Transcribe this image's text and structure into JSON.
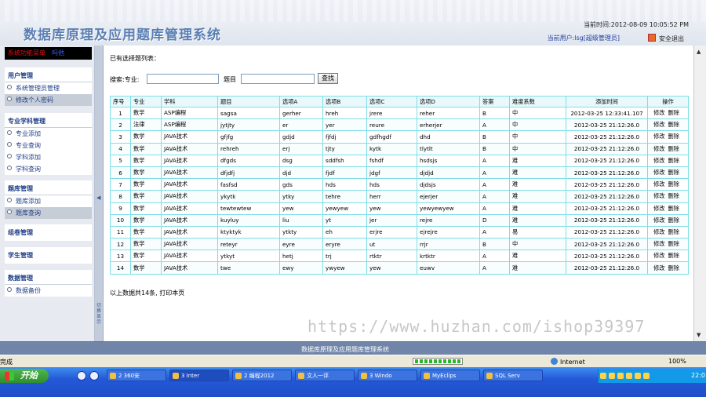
{
  "header": {
    "app_title": "数据库原理及应用题库管理系统",
    "current_time": "当前时间:2012-08-09 10:05:52 PM",
    "current_user": "当前用户:lsg[超级管理员]",
    "exit_label": "安全退出"
  },
  "sidebar": {
    "shortcut_label": "系统功能菜单",
    "shortcut_extra": "吗他",
    "sections": [
      {
        "title": "用户管理",
        "items": [
          "系统管理员管理",
          "修改个人密码"
        ]
      },
      {
        "title": "专业学科管理",
        "items": [
          "专业添加",
          "专业查询",
          "学科添加",
          "学科查询"
        ]
      },
      {
        "title": "题库管理",
        "items": [
          "题库添加",
          "题库查询"
        ]
      },
      {
        "title": "组卷管理",
        "items": []
      },
      {
        "title": "学生管理",
        "items": []
      },
      {
        "title": "数据管理",
        "items": [
          "数据备份"
        ]
      }
    ]
  },
  "main": {
    "list_title": "已有选择题列表：",
    "search_label": "搜索:专业:",
    "title_label": "题目",
    "find_button": "查找",
    "columns": [
      "序号",
      "专业",
      "学科",
      "题目",
      "选项A",
      "选项B",
      "选项C",
      "选项D",
      "答案",
      "难度系数",
      "添加时间",
      "操作"
    ],
    "edit_label": "修改",
    "delete_label": "删除",
    "rows": [
      [
        "1",
        "数学",
        "ASP编程",
        "sagsa",
        "gerher",
        "hreh",
        "jrere",
        "reher",
        "B",
        "中",
        "2012-03-25 12:33:41.107"
      ],
      [
        "2",
        "法律",
        "ASP编程",
        "jytjty",
        "er",
        "yer",
        "reure",
        "erherjer",
        "A",
        "中",
        "2012-03-25 21:12:26.0"
      ],
      [
        "3",
        "数学",
        "JAVA技术",
        "gfjfg",
        "gdjd",
        "fjfdj",
        "gdfhgdf",
        "dhd",
        "B",
        "中",
        "2012-03-25 21:12:26.0"
      ],
      [
        "4",
        "数学",
        "JAVA技术",
        "rehreh",
        "erj",
        "tjty",
        "kytk",
        "tlytlt",
        "B",
        "中",
        "2012-03-25 21:12:26.0"
      ],
      [
        "5",
        "数学",
        "JAVA技术",
        "dfgds",
        "dsg",
        "sddfsh",
        "fshdf",
        "hsdsjs",
        "A",
        "难",
        "2012-03-25 21:12:26.0"
      ],
      [
        "6",
        "数学",
        "JAVA技术",
        "dfjdfj",
        "djd",
        "fjdf",
        "jdgf",
        "djdjd",
        "A",
        "难",
        "2012-03-25 21:12:26.0"
      ],
      [
        "7",
        "数学",
        "JAVA技术",
        "fasfsd",
        "gds",
        "hds",
        "hds",
        "djdsjs",
        "A",
        "难",
        "2012-03-25 21:12:26.0"
      ],
      [
        "8",
        "数学",
        "JAVA技术",
        "ykytk",
        "ytky",
        "tehre",
        "herr",
        "ejerjer",
        "A",
        "难",
        "2012-03-25 21:12:26.0"
      ],
      [
        "9",
        "数学",
        "JAVA技术",
        "tewtewtew",
        "yew",
        "yewyew",
        "yew",
        "yewyewyew",
        "A",
        "难",
        "2012-03-25 21:12:26.0"
      ],
      [
        "10",
        "数学",
        "JAVA技术",
        "kuyluy",
        "liu",
        "yt",
        "jer",
        "rejre",
        "D",
        "难",
        "2012-03-25 21:12:26.0"
      ],
      [
        "11",
        "数学",
        "JAVA技术",
        "ktyktyk",
        "ytkty",
        "eh",
        "erjre",
        "ejrejre",
        "A",
        "易",
        "2012-03-25 21:12:26.0"
      ],
      [
        "12",
        "数学",
        "JAVA技术",
        "reteyr",
        "eyre",
        "eryre",
        "ut",
        "rrjr",
        "B",
        "中",
        "2012-03-25 21:12:26.0"
      ],
      [
        "13",
        "数学",
        "JAVA技术",
        "ytkyt",
        "hetj",
        "trj",
        "rtktr",
        "krtktr",
        "A",
        "难",
        "2012-03-25 21:12:26.0"
      ],
      [
        "14",
        "数学",
        "JAVA技术",
        "twe",
        "ewy",
        "ywyew",
        "yew",
        "euwv",
        "A",
        "难",
        "2012-03-25 21:12:26.0"
      ]
    ],
    "footer_note": "以上数据共14条, 打印本页"
  },
  "splitter_text": "切换显示",
  "watermark": "https://www.huzhan.com/ishop39397",
  "page_footer": "数据库原理及应用题库管理系统",
  "browser_status": {
    "done": "完成",
    "zone": "Internet",
    "zoom": "100%"
  },
  "taskbar": {
    "start_label": "开始",
    "tasks": [
      "2 360安",
      "3 Inter",
      "2 编程2012",
      "文人一评",
      "3 Windo",
      "MyEclips",
      "SQL Serv"
    ],
    "clock": "22:0"
  }
}
